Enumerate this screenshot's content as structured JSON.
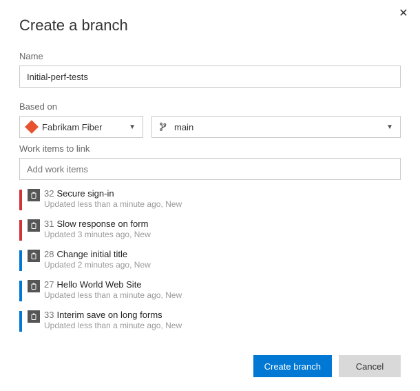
{
  "dialog": {
    "title": "Create a branch"
  },
  "fields": {
    "name_label": "Name",
    "name_value": "Initial-perf-tests",
    "based_on_label": "Based on",
    "repo_value": "Fabrikam Fiber",
    "branch_value": "main",
    "work_items_label": "Work items to link",
    "work_items_placeholder": "Add work items"
  },
  "work_items": [
    {
      "id": "32",
      "title": "Secure sign-in",
      "sub": "Updated less than a minute ago, New",
      "color": "red"
    },
    {
      "id": "31",
      "title": "Slow response on form",
      "sub": "Updated 3 minutes ago, New",
      "color": "red"
    },
    {
      "id": "28",
      "title": "Change initial title",
      "sub": "Updated 2 minutes ago, New",
      "color": "blue"
    },
    {
      "id": "27",
      "title": "Hello World Web Site",
      "sub": "Updated less than a minute ago, New",
      "color": "blue"
    },
    {
      "id": "33",
      "title": "Interim save on long forms",
      "sub": "Updated less than a minute ago, New",
      "color": "blue"
    }
  ],
  "buttons": {
    "primary": "Create branch",
    "secondary": "Cancel"
  }
}
